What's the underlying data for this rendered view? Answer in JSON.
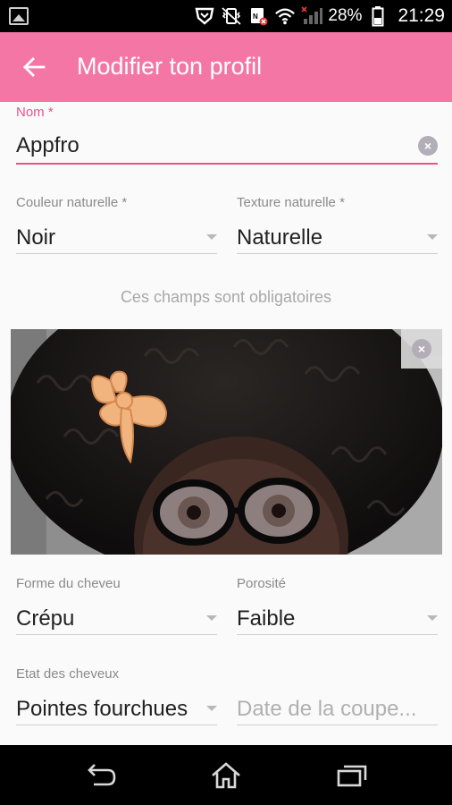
{
  "status_bar": {
    "battery_percent": "28%",
    "time": "21:29"
  },
  "app_bar": {
    "title": "Modifier ton profil"
  },
  "form": {
    "name": {
      "label": "Nom *",
      "value": "Appfro"
    },
    "natural_color": {
      "label": "Couleur naturelle *",
      "value": "Noir"
    },
    "natural_texture": {
      "label": "Texture naturelle *",
      "value": "Naturelle"
    },
    "required_hint": "Ces champs sont obligatoires",
    "hair_shape": {
      "label": "Forme du cheveu",
      "value": "Crépu"
    },
    "porosity": {
      "label": "Porosité",
      "value": "Faible"
    },
    "hair_state": {
      "label": "Etat des cheveux",
      "value": "Pointes fourchues"
    },
    "cut_date": {
      "placeholder": "Date de la coupe..."
    }
  },
  "colors": {
    "accent": "#f476a5",
    "accent_dark": "#e8538a"
  }
}
